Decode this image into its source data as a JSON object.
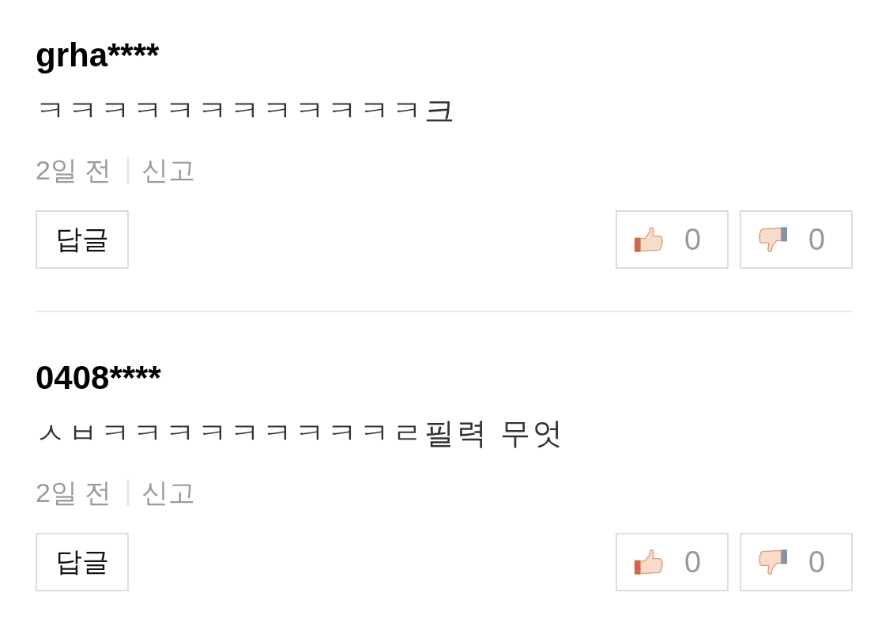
{
  "comments": [
    {
      "username": "grha****",
      "text": "ㅋㅋㅋㅋㅋㅋㅋㅋㅋㅋㅋㅋ크",
      "time": "2일 전",
      "report_link": "신고",
      "reply_button": "답글",
      "likes": "0",
      "dislikes": "0"
    },
    {
      "username": "0408****",
      "text": "ㅅㅂㅋㅋㅋㅋㅋㅋㅋㅋㅋㄹ필력 무엇",
      "time": "2일 전",
      "report_link": "신고",
      "reply_button": "답글",
      "likes": "0",
      "dislikes": "0"
    }
  ]
}
